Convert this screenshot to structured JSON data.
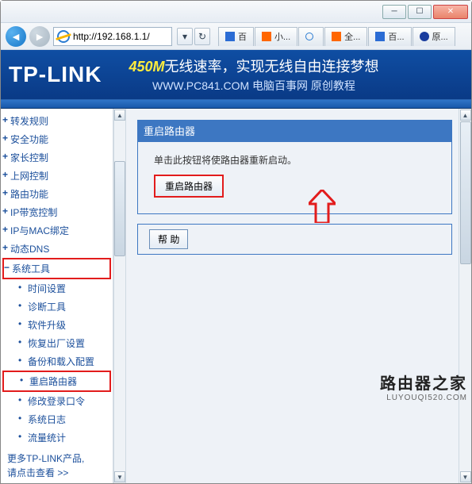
{
  "window": {
    "url": "http://192.168.1.1/",
    "tabs": [
      {
        "icon": "baidu",
        "label": "百"
      },
      {
        "icon": "mi",
        "label": "小..."
      },
      {
        "icon": "ie",
        "label": ""
      },
      {
        "icon": "mi",
        "label": "全..."
      },
      {
        "icon": "baidu",
        "label": "百..."
      },
      {
        "icon": "info",
        "label": "原..."
      }
    ]
  },
  "banner": {
    "logo": "TP-LINK",
    "highlight": "450M",
    "line1_rest": "无线速率，实现无线自由连接梦想",
    "line2": "WWW.PC841.COM 电脑百事网 原创教程"
  },
  "sidebar": {
    "items": [
      {
        "label": "转发规则",
        "type": "parent"
      },
      {
        "label": "安全功能",
        "type": "parent"
      },
      {
        "label": "家长控制",
        "type": "parent"
      },
      {
        "label": "上网控制",
        "type": "parent"
      },
      {
        "label": "路由功能",
        "type": "parent"
      },
      {
        "label": "IP带宽控制",
        "type": "parent"
      },
      {
        "label": "IP与MAC绑定",
        "type": "parent"
      },
      {
        "label": "动态DNS",
        "type": "parent"
      },
      {
        "label": "系统工具",
        "type": "parent expanded",
        "red": true
      },
      {
        "label": "时间设置",
        "type": "child"
      },
      {
        "label": "诊断工具",
        "type": "child"
      },
      {
        "label": "软件升级",
        "type": "child"
      },
      {
        "label": "恢复出厂设置",
        "type": "child"
      },
      {
        "label": "备份和载入配置",
        "type": "child"
      },
      {
        "label": "重启路由器",
        "type": "child",
        "red": true
      },
      {
        "label": "修改登录口令",
        "type": "child"
      },
      {
        "label": "系统日志",
        "type": "child"
      },
      {
        "label": "流量统计",
        "type": "child"
      }
    ],
    "footer_line1": "更多TP-LINK产品,",
    "footer_line2": "请点击查看 >>"
  },
  "main": {
    "panel_title": "重启路由器",
    "hint": "单击此按钮将使路由器重新启动。",
    "btn_reboot": "重启路由器",
    "btn_help": "帮 助"
  },
  "watermark": {
    "cn": "路由器之家",
    "en": "LUYOUQI520.COM"
  }
}
